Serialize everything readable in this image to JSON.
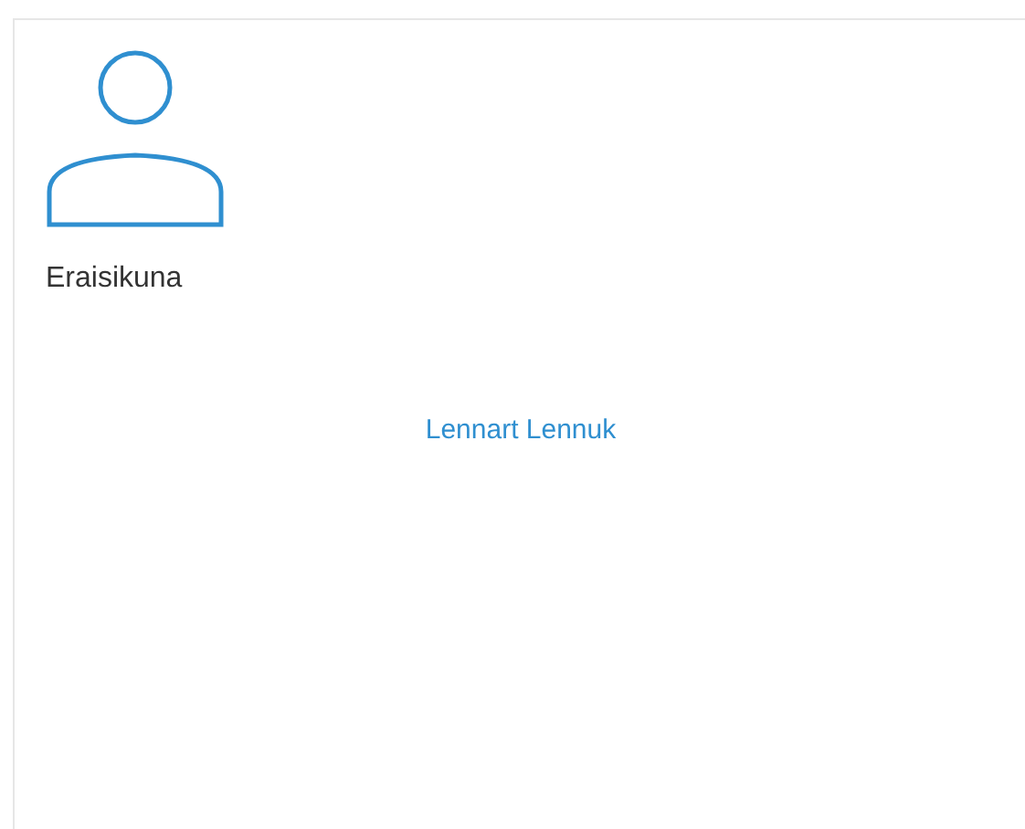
{
  "profile": {
    "label": "Eraisikuna",
    "link": "Lennart Lennuk"
  }
}
